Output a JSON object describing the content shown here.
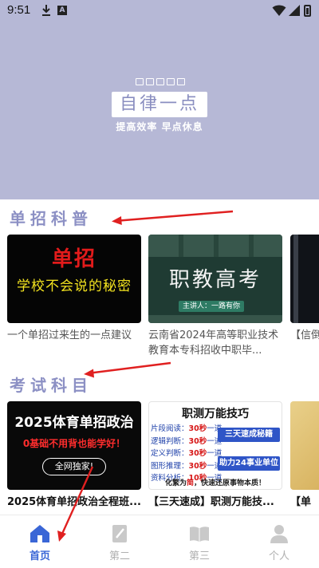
{
  "status_bar": {
    "time": "9:51",
    "icons": [
      "download-icon",
      "a-icon",
      "wifi-icon",
      "signal-icon",
      "battery-icon"
    ]
  },
  "banner": {
    "logo_title": "自律一点",
    "logo_subtitle": "提高效率 早点休息",
    "background_color": "#b6b8d6"
  },
  "sections": [
    {
      "title": "单招科普",
      "items": [
        {
          "thumb_title": "单招",
          "thumb_subtitle": "学校不会说的秘密",
          "caption": "一个单招过来生的一点建议"
        },
        {
          "thumb_title": "职教高考",
          "thumb_tag": "主讲人：一路有你",
          "caption": "云南省2024年高等职业技术教育本专科招收中职毕..."
        },
        {
          "caption": "【信倒，"
        }
      ]
    },
    {
      "title": "考试科目",
      "items": [
        {
          "thumb_title": "2025体育单招政治",
          "thumb_red": "0基础不用背也能学好！",
          "thumb_pill": "全网独家!",
          "caption": "2025体育单招政治全程班..."
        },
        {
          "thumb_title": "职测万能技巧",
          "thumb_items": [
            {
              "label": "片段阅读：",
              "time": "30秒",
              "suffix": "一道"
            },
            {
              "label": "逻辑判断：",
              "time": "30秒",
              "suffix": "一道"
            },
            {
              "label": "定义判断：",
              "time": "30秒",
              "suffix": "一道"
            },
            {
              "label": "图形推理：",
              "time": "30秒",
              "suffix": "一道"
            },
            {
              "label": "资料分析：",
              "time": "10秒",
              "suffix": "一道"
            }
          ],
          "thumb_btn1": "三天速成秘籍",
          "thumb_btn2": "助力24事业单位",
          "thumb_foot_a": "化繁为",
          "thumb_foot_b": "简",
          "thumb_foot_c": "，快速还原事物本质！",
          "caption": "【三天速成】职测万能技..."
        },
        {
          "caption": "【单"
        }
      ]
    }
  ],
  "bottom_nav": [
    {
      "label": "首页",
      "icon": "home-icon",
      "active": true
    },
    {
      "label": "第二",
      "icon": "edit-icon",
      "active": false
    },
    {
      "label": "第三",
      "icon": "book-icon",
      "active": false
    },
    {
      "label": "个人",
      "icon": "person-icon",
      "active": false
    }
  ],
  "colors": {
    "accent": "#3a66d6",
    "section_title": "#8c90c4",
    "annotation_arrow": "#e02020"
  }
}
